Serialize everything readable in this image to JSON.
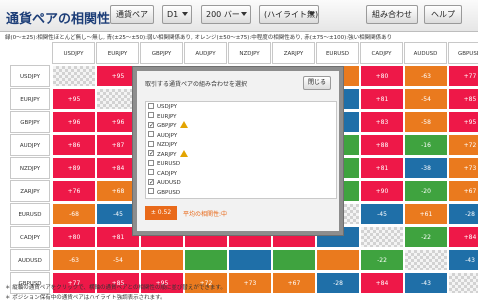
{
  "header": {
    "title": "通貨ペアの相関性",
    "pair_button": "通貨ペア",
    "timeframe": "D1",
    "bars": "200 バー",
    "highlight": "(ハイライト無)",
    "combine_button": "組み合わせ",
    "help_button": "ヘルプ"
  },
  "legend": "緑(0～±25):相関性ほとんど無し～無し, 青(±25～±50):弱い相関関係あり, オレンジ(±50～±75):中程度の相関性あり, 赤(±75～±100):強い相関関係あり",
  "colors": {
    "red": "#ee1848",
    "blue": "#1f6fa8",
    "orange": "#ea7a1e",
    "green": "#3fa33f"
  },
  "pairs": [
    "USDJPY",
    "EURJPY",
    "GBPJPY",
    "AUDJPY",
    "NZDJPY",
    "ZARJPY",
    "EURUSD",
    "CADJPY",
    "AUDUSD",
    "GBPUSD"
  ],
  "rows": [
    {
      "label": "USDJPY",
      "cells": [
        {
          "v": "",
          "c": "diag"
        },
        {
          "v": "+95",
          "c": "red"
        },
        {
          "v": "",
          "c": "red"
        },
        {
          "v": "",
          "c": "red"
        },
        {
          "v": "",
          "c": "red"
        },
        {
          "v": "",
          "c": "red"
        },
        {
          "v": "",
          "c": "orange"
        },
        {
          "v": "+80",
          "c": "red"
        },
        {
          "v": "-63",
          "c": "orange"
        },
        {
          "v": "+77",
          "c": "red"
        }
      ]
    },
    {
      "label": "EURJPY",
      "cells": [
        {
          "v": "+95",
          "c": "red"
        },
        {
          "v": "",
          "c": "diag"
        },
        {
          "v": "",
          "c": "red"
        },
        {
          "v": "",
          "c": "red"
        },
        {
          "v": "",
          "c": "red"
        },
        {
          "v": "",
          "c": "red"
        },
        {
          "v": "",
          "c": "blue"
        },
        {
          "v": "+81",
          "c": "red"
        },
        {
          "v": "-54",
          "c": "orange"
        },
        {
          "v": "+85",
          "c": "red"
        }
      ]
    },
    {
      "label": "GBPJPY",
      "cells": [
        {
          "v": "+96",
          "c": "red"
        },
        {
          "v": "+96",
          "c": "red"
        },
        {
          "v": "",
          "c": "diag"
        },
        {
          "v": "",
          "c": "red"
        },
        {
          "v": "",
          "c": "red"
        },
        {
          "v": "",
          "c": "red"
        },
        {
          "v": "",
          "c": "blue"
        },
        {
          "v": "+83",
          "c": "red"
        },
        {
          "v": "-58",
          "c": "orange"
        },
        {
          "v": "+95",
          "c": "red"
        }
      ]
    },
    {
      "label": "AUDJPY",
      "cells": [
        {
          "v": "+86",
          "c": "red"
        },
        {
          "v": "+87",
          "c": "red"
        },
        {
          "v": "",
          "c": "red"
        },
        {
          "v": "",
          "c": "diag"
        },
        {
          "v": "",
          "c": "red"
        },
        {
          "v": "",
          "c": "red"
        },
        {
          "v": "",
          "c": "green"
        },
        {
          "v": "+88",
          "c": "red"
        },
        {
          "v": "-16",
          "c": "green"
        },
        {
          "v": "+72",
          "c": "orange"
        }
      ]
    },
    {
      "label": "NZDJPY",
      "cells": [
        {
          "v": "+89",
          "c": "red"
        },
        {
          "v": "+84",
          "c": "red"
        },
        {
          "v": "",
          "c": "red"
        },
        {
          "v": "",
          "c": "red"
        },
        {
          "v": "",
          "c": "diag"
        },
        {
          "v": "",
          "c": "red"
        },
        {
          "v": "",
          "c": "green"
        },
        {
          "v": "+81",
          "c": "red"
        },
        {
          "v": "-38",
          "c": "blue"
        },
        {
          "v": "+73",
          "c": "orange"
        }
      ]
    },
    {
      "label": "ZARJPY",
      "cells": [
        {
          "v": "+76",
          "c": "red"
        },
        {
          "v": "+68",
          "c": "orange"
        },
        {
          "v": "",
          "c": "orange"
        },
        {
          "v": "",
          "c": "red"
        },
        {
          "v": "",
          "c": "red"
        },
        {
          "v": "",
          "c": "diag"
        },
        {
          "v": "",
          "c": "green"
        },
        {
          "v": "+90",
          "c": "red"
        },
        {
          "v": "-20",
          "c": "green"
        },
        {
          "v": "+67",
          "c": "orange"
        }
      ]
    },
    {
      "label": "EURUSD",
      "cells": [
        {
          "v": "-68",
          "c": "orange"
        },
        {
          "v": "-45",
          "c": "blue"
        },
        {
          "v": "",
          "c": "blue"
        },
        {
          "v": "",
          "c": "green"
        },
        {
          "v": "",
          "c": "green"
        },
        {
          "v": "",
          "c": "green"
        },
        {
          "v": "",
          "c": "diag"
        },
        {
          "v": "-45",
          "c": "blue"
        },
        {
          "v": "+61",
          "c": "orange"
        },
        {
          "v": "-28",
          "c": "blue"
        }
      ]
    },
    {
      "label": "CADJPY",
      "cells": [
        {
          "v": "+80",
          "c": "red"
        },
        {
          "v": "+81",
          "c": "red"
        },
        {
          "v": "",
          "c": "red"
        },
        {
          "v": "",
          "c": "red"
        },
        {
          "v": "",
          "c": "red"
        },
        {
          "v": "",
          "c": "red"
        },
        {
          "v": "",
          "c": "blue"
        },
        {
          "v": "",
          "c": "diag"
        },
        {
          "v": "-22",
          "c": "green"
        },
        {
          "v": "+84",
          "c": "red"
        }
      ]
    },
    {
      "label": "AUDUSD",
      "cells": [
        {
          "v": "-63",
          "c": "orange"
        },
        {
          "v": "-54",
          "c": "orange"
        },
        {
          "v": "",
          "c": "orange"
        },
        {
          "v": "",
          "c": "green"
        },
        {
          "v": "",
          "c": "blue"
        },
        {
          "v": "",
          "c": "green"
        },
        {
          "v": "",
          "c": "orange"
        },
        {
          "v": "-22",
          "c": "green"
        },
        {
          "v": "",
          "c": "diag"
        },
        {
          "v": "-43",
          "c": "blue"
        }
      ]
    },
    {
      "label": "GBPUSD",
      "cells": [
        {
          "v": "+77",
          "c": "red"
        },
        {
          "v": "+85",
          "c": "red"
        },
        {
          "v": "+95",
          "c": "red"
        },
        {
          "v": "+72",
          "c": "orange"
        },
        {
          "v": "+73",
          "c": "orange"
        },
        {
          "v": "+67",
          "c": "orange"
        },
        {
          "v": "-28",
          "c": "blue"
        },
        {
          "v": "+84",
          "c": "red"
        },
        {
          "v": "-43",
          "c": "blue"
        },
        {
          "v": "",
          "c": "diag"
        }
      ]
    }
  ],
  "modal": {
    "title": "取引する通貨ペアの組み合わせを選択",
    "close": "閉じる",
    "items": [
      {
        "label": "USDJPY",
        "checked": false,
        "warn": false
      },
      {
        "label": "EURJPY",
        "checked": false,
        "warn": false
      },
      {
        "label": "GBPJPY",
        "checked": true,
        "warn": true
      },
      {
        "label": "AUDJPY",
        "checked": false,
        "warn": false
      },
      {
        "label": "NZDJPY",
        "checked": false,
        "warn": false
      },
      {
        "label": "ZARJPY",
        "checked": true,
        "warn": true
      },
      {
        "label": "EURUSD",
        "checked": false,
        "warn": false
      },
      {
        "label": "CADJPY",
        "checked": false,
        "warn": false
      },
      {
        "label": "AUDUSD",
        "checked": true,
        "warn": false
      },
      {
        "label": "GBPUSD",
        "checked": false,
        "warn": false
      }
    ],
    "avg_value": "± 0.52",
    "avg_text": "平均の相関性:中"
  },
  "footer": [
    "＊ 縦軸の通貨ペアをクリックで、横軸の通貨ペアとの相関性の順に並び替えができます。",
    "＊ ポジション保有中の通貨ペアはハイライト強調表示されます。"
  ]
}
